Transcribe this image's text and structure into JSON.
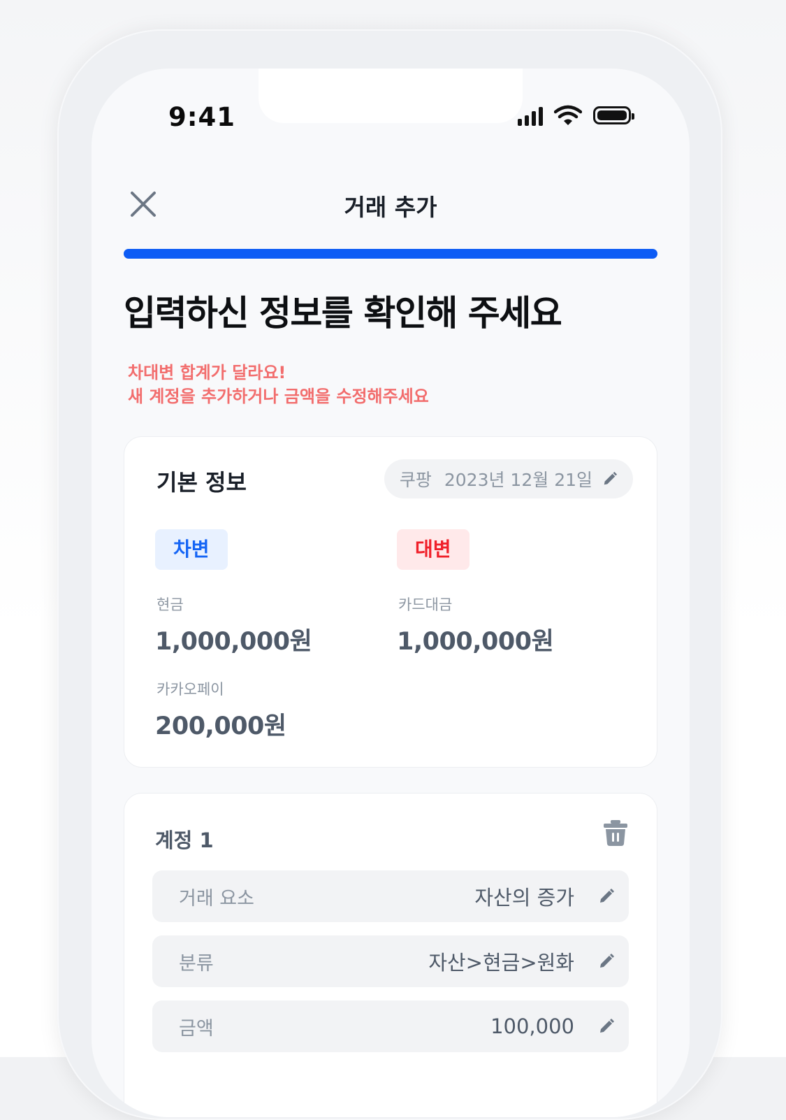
{
  "status_bar": {
    "time": "9:41"
  },
  "header": {
    "title": "거래 추가",
    "progress": 1.0,
    "accent_color": "#0d5cf5"
  },
  "headline": "입력하신 정보를 확인해 주세요",
  "warning": {
    "line1": "차대변 합계가 달라요!",
    "line2": "새 계정을 추가하거나 금액을 수정해주세요",
    "color": "#f26d6d"
  },
  "basic_info": {
    "title": "기본 정보",
    "store": "쿠팡",
    "date": "2023년 12월 21일",
    "debit": {
      "label": "차변",
      "entries": [
        {
          "name": "현금",
          "amount": "1,000,000원"
        },
        {
          "name": "카카오페이",
          "amount": "200,000원"
        }
      ]
    },
    "credit": {
      "label": "대변",
      "entries": [
        {
          "name": "카드대금",
          "amount": "1,000,000원"
        }
      ]
    }
  },
  "account": {
    "title": "계정 1",
    "fields": [
      {
        "label": "거래 요소",
        "value": "자산의 증가"
      },
      {
        "label": "분류",
        "value": "자산>현금>원화"
      },
      {
        "label": "금액",
        "value": "100,000"
      }
    ]
  },
  "icons": [
    "close-icon",
    "pencil-icon",
    "trash-icon",
    "signal-icon",
    "wifi-icon",
    "battery-icon"
  ]
}
